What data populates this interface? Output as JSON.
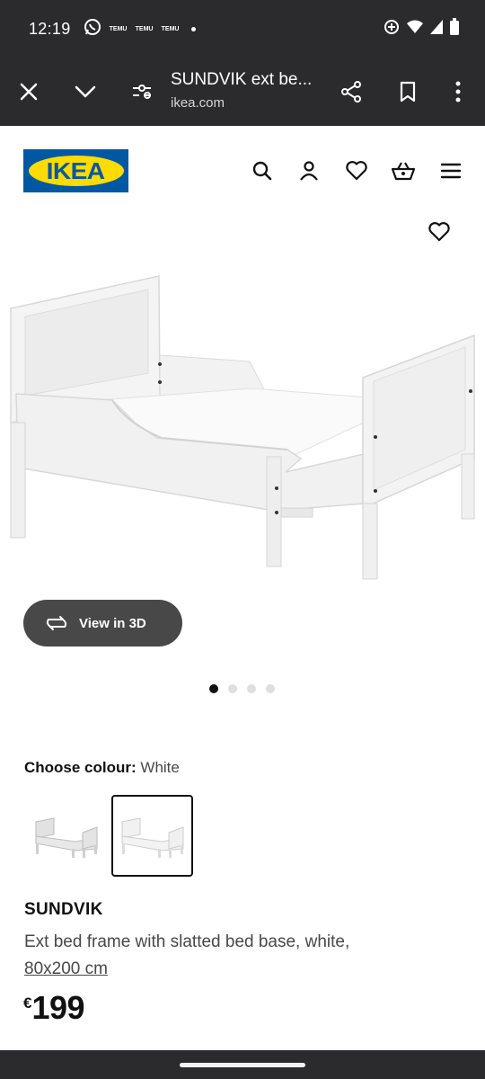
{
  "status_bar": {
    "time": "12:19",
    "notifications": [
      "TEMU",
      "TEMU",
      "TEMU"
    ]
  },
  "browser": {
    "page_title": "SUNDVIK ext be...",
    "url": "ikea.com"
  },
  "header": {
    "logo_text": "IKEA"
  },
  "product": {
    "view_3d_label": "View in 3D",
    "carousel": {
      "count": 4,
      "active_index": 0
    },
    "colour_label": "Choose colour:",
    "colour_value": "White",
    "swatches": [
      {
        "name": "swatch-grey",
        "selected": false
      },
      {
        "name": "swatch-white",
        "selected": true
      }
    ],
    "name": "SUNDVIK",
    "description": "Ext bed frame with slatted bed base, white,",
    "size": "80x200 cm",
    "currency": "€",
    "price": "199"
  },
  "colors": {
    "ikea_blue": "#0058a3",
    "ikea_yellow": "#ffdb00",
    "system_bar": "#2b2b2d",
    "view3d_bg": "#484848"
  }
}
